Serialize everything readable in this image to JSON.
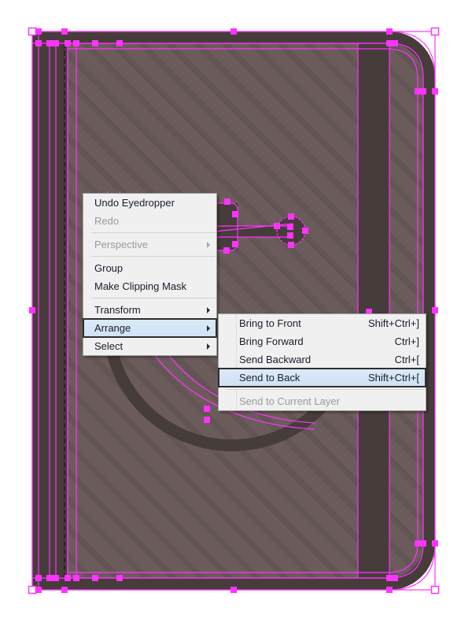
{
  "app": {
    "scene": "vector-illustration-notebook",
    "canvas_background": "#ffffff"
  },
  "colors": {
    "cover_dark": "#463c3a",
    "page_stripe_base": "#6b5c5b",
    "path_magenta": "#ff33ff",
    "menu_background": "#f0f0f0",
    "menu_highlight": "#cfe2f4",
    "menu_text": "#1b1b2b",
    "menu_text_disabled": "#9a9a9a"
  },
  "artwork": {
    "name": "notebook-with-pencil",
    "selection_state": "selected",
    "shapes": [
      {
        "name": "notebook-cover",
        "type": "rounded-rect"
      },
      {
        "name": "notebook-pages",
        "type": "rounded-rect-striped"
      },
      {
        "name": "binding-strip",
        "type": "rect"
      },
      {
        "name": "perforation-line",
        "type": "dashed-line"
      },
      {
        "name": "pencil",
        "type": "compound-path"
      },
      {
        "name": "elastic-band-arc",
        "type": "arc"
      }
    ]
  },
  "context_menu": {
    "name": "canvas-context-menu",
    "items": [
      {
        "label": "Undo Eyedropper",
        "accel": "",
        "disabled": false,
        "submenu": false,
        "separator_after": false
      },
      {
        "label": "Redo",
        "accel": "",
        "disabled": true,
        "submenu": false,
        "separator_after": true
      },
      {
        "label": "Perspective",
        "accel": "",
        "disabled": true,
        "submenu": true,
        "separator_after": true
      },
      {
        "label": "Group",
        "accel": "",
        "disabled": false,
        "submenu": false,
        "separator_after": false
      },
      {
        "label": "Make Clipping Mask",
        "accel": "",
        "disabled": false,
        "submenu": false,
        "separator_after": true
      },
      {
        "label": "Transform",
        "accel": "",
        "disabled": false,
        "submenu": true,
        "separator_after": false
      },
      {
        "label": "Arrange",
        "accel": "",
        "disabled": false,
        "submenu": true,
        "separator_after": false,
        "highlighted": true
      },
      {
        "label": "Select",
        "accel": "",
        "disabled": false,
        "submenu": true,
        "separator_after": false
      }
    ]
  },
  "arrange_submenu": {
    "name": "arrange-submenu",
    "items": [
      {
        "label": "Bring to Front",
        "accel": "Shift+Ctrl+]",
        "disabled": false,
        "separator_after": false
      },
      {
        "label": "Bring Forward",
        "accel": "Ctrl+]",
        "disabled": false,
        "separator_after": false
      },
      {
        "label": "Send Backward",
        "accel": "Ctrl+[",
        "disabled": false,
        "separator_after": false
      },
      {
        "label": "Send to Back",
        "accel": "Shift+Ctrl+[",
        "disabled": false,
        "separator_after": true,
        "highlighted": true
      },
      {
        "label": "Send to Current Layer",
        "accel": "",
        "disabled": true,
        "separator_after": false
      }
    ]
  }
}
